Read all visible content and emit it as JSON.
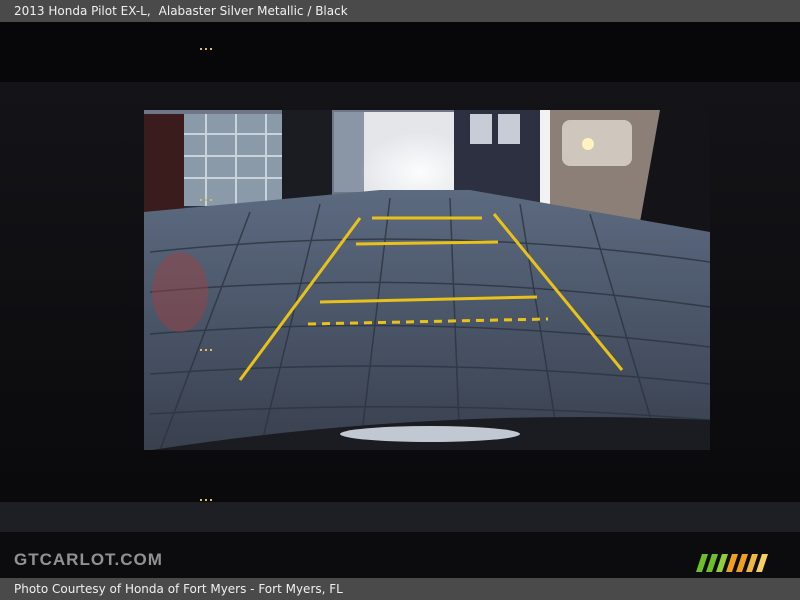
{
  "header": {
    "title": "2013 Honda Pilot EX-L,",
    "color": "Alabaster Silver Metallic / Black"
  },
  "watermark": {
    "text": "GTCARLOT.COM"
  },
  "footer": {
    "credit": "Photo Courtesy of Honda of Fort Myers - Fort Myers, FL"
  },
  "colors": {
    "guide_line": "#e8c21a",
    "bar_background": "#4a4a4a",
    "logo_green": "#6fbf2a",
    "logo_orange": "#f0a020"
  }
}
